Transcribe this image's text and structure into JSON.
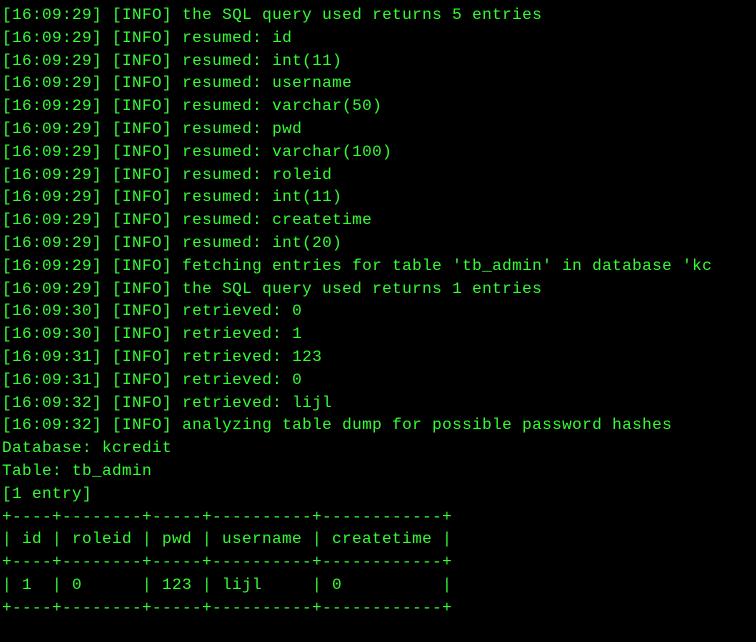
{
  "log_lines": [
    {
      "time": "[16:09:29]",
      "level": "[INFO]",
      "msg": "the SQL query used returns 5 entries"
    },
    {
      "time": "[16:09:29]",
      "level": "[INFO]",
      "msg": "resumed: id"
    },
    {
      "time": "[16:09:29]",
      "level": "[INFO]",
      "msg": "resumed: int(11)"
    },
    {
      "time": "[16:09:29]",
      "level": "[INFO]",
      "msg": "resumed: username"
    },
    {
      "time": "[16:09:29]",
      "level": "[INFO]",
      "msg": "resumed: varchar(50)"
    },
    {
      "time": "[16:09:29]",
      "level": "[INFO]",
      "msg": "resumed: pwd"
    },
    {
      "time": "[16:09:29]",
      "level": "[INFO]",
      "msg": "resumed: varchar(100)"
    },
    {
      "time": "[16:09:29]",
      "level": "[INFO]",
      "msg": "resumed: roleid"
    },
    {
      "time": "[16:09:29]",
      "level": "[INFO]",
      "msg": "resumed: int(11)"
    },
    {
      "time": "[16:09:29]",
      "level": "[INFO]",
      "msg": "resumed: createtime"
    },
    {
      "time": "[16:09:29]",
      "level": "[INFO]",
      "msg": "resumed: int(20)"
    },
    {
      "time": "[16:09:29]",
      "level": "[INFO]",
      "msg": "fetching entries for table 'tb_admin' in database 'kc"
    },
    {
      "time": "[16:09:29]",
      "level": "[INFO]",
      "msg": "the SQL query used returns 1 entries"
    },
    {
      "time": "[16:09:30]",
      "level": "[INFO]",
      "msg": "retrieved: 0"
    },
    {
      "time": "[16:09:30]",
      "level": "[INFO]",
      "msg": "retrieved: 1"
    },
    {
      "time": "[16:09:31]",
      "level": "[INFO]",
      "msg": "retrieved: 123"
    },
    {
      "time": "[16:09:31]",
      "level": "[INFO]",
      "msg": "retrieved: 0"
    },
    {
      "time": "[16:09:32]",
      "level": "[INFO]",
      "msg": "retrieved: lijl"
    },
    {
      "time": "[16:09:32]",
      "level": "[INFO]",
      "msg": "analyzing table dump for possible password hashes"
    }
  ],
  "db_line": "Database: kcredit",
  "table_line": "Table: tb_admin",
  "entry_count_line": "[1 entry]",
  "table_sep": "+----+--------+-----+----------+------------+",
  "table_hdr": "| id | roleid | pwd | username | createtime |",
  "table_row": "| 1  | 0      | 123 | lijl     | 0          |"
}
